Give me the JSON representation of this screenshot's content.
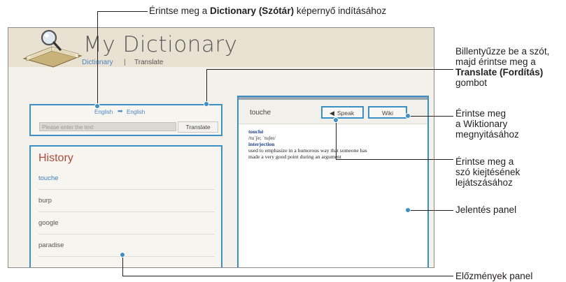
{
  "callouts": {
    "dictionary": "Érintse meg a ",
    "dictionary_bold": "Dictionary (Szótár)",
    "dictionary_tail": " képernyő indításához",
    "input_l1": "Billentyűzze be a szót,",
    "input_l2": "majd érintse meg a",
    "input_bold": "Translate (Fordítás)",
    "input_l4": "gombot",
    "wiki_l1": "Érintse meg",
    "wiki_l2": "a Wiktionary",
    "wiki_l3": "megnyitásához",
    "speak_l1": "Érintse meg a",
    "speak_l2": "szó kiejtésének",
    "speak_l3": "lejátszásához",
    "meaning": "Jelentés panel",
    "history": "Előzmények panel"
  },
  "app": {
    "title": "My Dictionary",
    "tabs": [
      "Dictionary",
      "|",
      "Translate"
    ]
  },
  "input": {
    "lang_from": "English",
    "lang_to": "English",
    "placeholder": "Please enter the text",
    "button": "Translate"
  },
  "history": {
    "title": "History",
    "items": [
      "touche",
      "burp",
      "google",
      "paradise"
    ]
  },
  "meaning": {
    "word": "touche",
    "speak": "Speak",
    "wiki": "Wiki",
    "headword": "touché",
    "pronunciation": "/tuˈʃe; ˈtuʃeɪ/",
    "pos": "interjection",
    "definition_l1": "used to emphasize in a humorous way that someone has",
    "definition_l2": "made a very good point during an argument"
  },
  "icons": {
    "arrow": "right-arrow-icon",
    "speaker": "speaker-icon",
    "logo": "book-magnifier-logo"
  },
  "colors": {
    "accent_blue": "#3a8fc6",
    "history_title": "#b24a3a",
    "link_blue": "#4a86c5"
  }
}
